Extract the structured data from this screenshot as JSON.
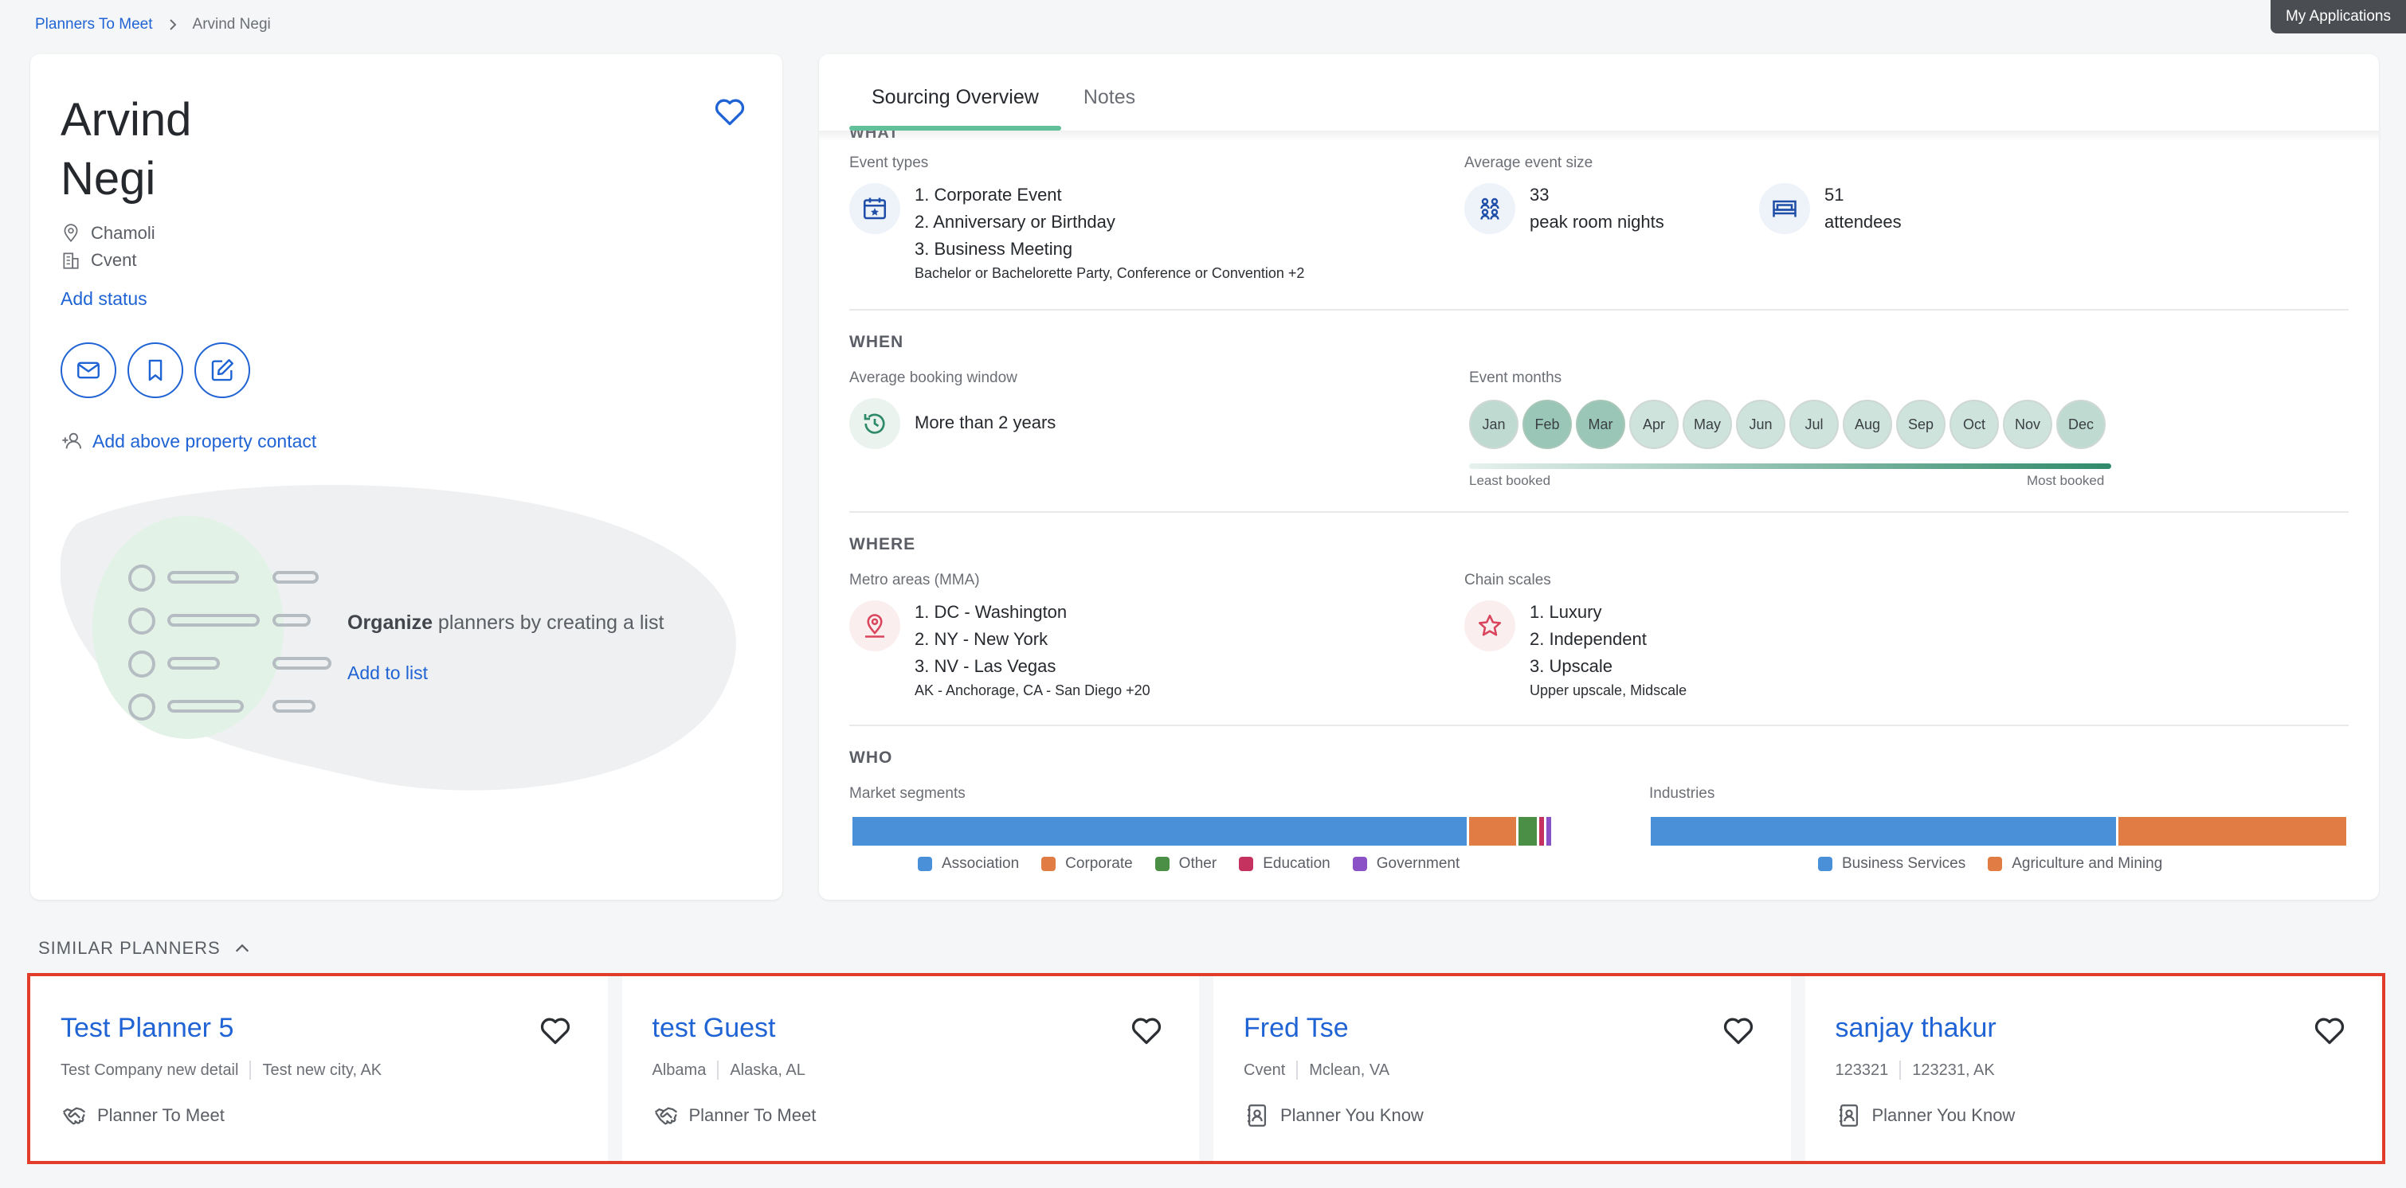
{
  "breadcrumb": {
    "parent": "Planners To Meet",
    "current": "Arvind Negi"
  },
  "header": {
    "my_applications": "My Applications"
  },
  "profile": {
    "first_name": "Arvind",
    "last_name": "Negi",
    "location": "Chamoli",
    "company": "Cvent",
    "add_status": "Add status",
    "add_contact": "Add above property contact",
    "organize_bold": "Organize",
    "organize_rest": " planners by creating a list",
    "add_to_list": "Add to list"
  },
  "tabs": [
    {
      "label": "Sourcing Overview",
      "active": true
    },
    {
      "label": "Notes",
      "active": false
    }
  ],
  "overview": {
    "what": {
      "cut_heading": "WHAT",
      "event_types_label": "Event types",
      "event_types": [
        "1. Corporate Event",
        "2. Anniversary or Birthday",
        "3. Business Meeting"
      ],
      "event_types_more": "Bachelor or Bachelorette Party, Conference or Convention +2",
      "avg_size_label": "Average event size",
      "room_nights_value": "33",
      "room_nights_unit": "peak room nights",
      "attendees_value": "51",
      "attendees_unit": "attendees"
    },
    "when": {
      "heading": "WHEN",
      "booking_window_label": "Average booking window",
      "booking_window_value": "More than 2 years",
      "event_months_label": "Event months",
      "months": [
        {
          "label": "Jan",
          "level": 0.35
        },
        {
          "label": "Feb",
          "level": 0.75
        },
        {
          "label": "Mar",
          "level": 0.75
        },
        {
          "label": "Apr",
          "level": 0.2
        },
        {
          "label": "May",
          "level": 0.2
        },
        {
          "label": "Jun",
          "level": 0.2
        },
        {
          "label": "Jul",
          "level": 0.2
        },
        {
          "label": "Aug",
          "level": 0.2
        },
        {
          "label": "Sep",
          "level": 0.2
        },
        {
          "label": "Oct",
          "level": 0.2
        },
        {
          "label": "Nov",
          "level": 0.2
        },
        {
          "label": "Dec",
          "level": 0.35
        }
      ],
      "least_booked": "Least booked",
      "most_booked": "Most booked"
    },
    "where": {
      "heading": "WHERE",
      "metro_label": "Metro areas (MMA)",
      "metro": [
        "1. DC - Washington",
        "2. NY - New York",
        "3. NV - Las Vegas"
      ],
      "metro_more": "AK - Anchorage, CA - San Diego +20",
      "chain_label": "Chain scales",
      "chain": [
        "1. Luxury",
        "2. Independent",
        "3. Upscale"
      ],
      "chain_more": "Upper upscale, Midscale"
    },
    "who": {
      "heading": "WHO",
      "segments_label": "Market segments",
      "segments": [
        {
          "name": "Association",
          "share": 0.88,
          "color": "#4a90d9"
        },
        {
          "name": "Corporate",
          "share": 0.07,
          "color": "#e07c44"
        },
        {
          "name": "Other",
          "share": 0.03,
          "color": "#4a8f45"
        },
        {
          "name": "Education",
          "share": 0.01,
          "color": "#c6325f"
        },
        {
          "name": "Government",
          "share": 0.01,
          "color": "#8a52c6"
        }
      ],
      "industries_label": "Industries",
      "industries": [
        {
          "name": "Business Services",
          "share": 0.67,
          "color": "#4a90d9"
        },
        {
          "name": "Agriculture and Mining",
          "share": 0.33,
          "color": "#e07c44"
        }
      ]
    }
  },
  "similar": {
    "heading": "SIMILAR PLANNERS",
    "cards": [
      {
        "name": "Test Planner 5",
        "company": "Test Company new detail",
        "location": "Test new city, AK",
        "tag": "Planner To Meet",
        "tag_icon": "handshake-icon"
      },
      {
        "name": "test Guest",
        "company": "Albama",
        "location": "Alaska, AL",
        "tag": "Planner To Meet",
        "tag_icon": "handshake-icon"
      },
      {
        "name": "Fred Tse",
        "company": "Cvent",
        "location": "Mclean, VA",
        "tag": "Planner You Know",
        "tag_icon": "contact-book-icon"
      },
      {
        "name": "sanjay thakur",
        "company": "123321",
        "location": "123231, AK",
        "tag": "Planner You Know",
        "tag_icon": "contact-book-icon"
      }
    ]
  }
}
